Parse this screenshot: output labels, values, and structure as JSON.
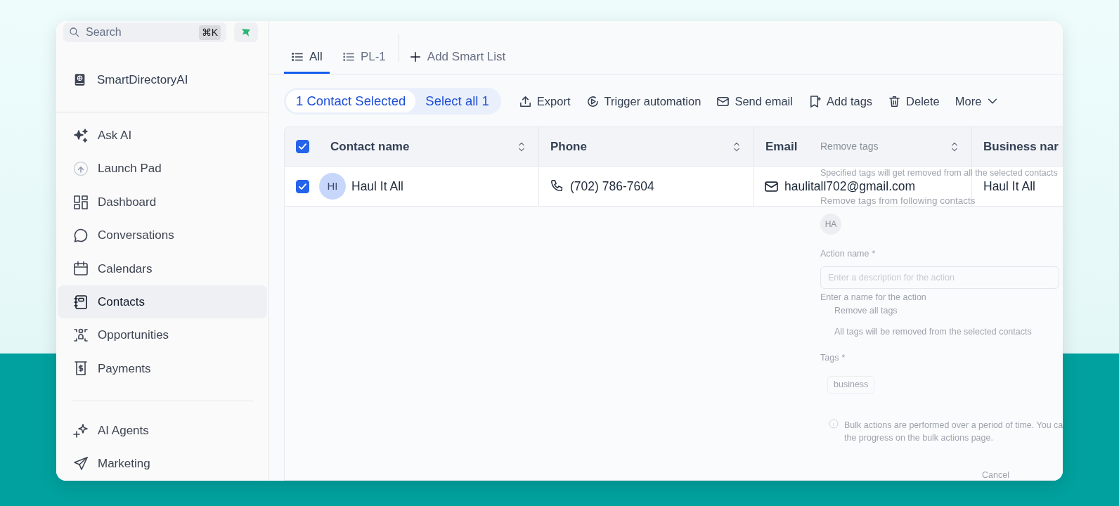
{
  "sidebar": {
    "search": {
      "placeholder": "Search",
      "shortcut": "⌘K"
    },
    "account": {
      "name": "SmartDirectoryAI"
    },
    "items": [
      {
        "label": "Ask AI",
        "selected": false
      },
      {
        "label": "Launch Pad",
        "selected": false
      },
      {
        "label": "Dashboard",
        "selected": false
      },
      {
        "label": "Conversations",
        "selected": false
      },
      {
        "label": "Calendars",
        "selected": false
      },
      {
        "label": "Contacts",
        "selected": true
      },
      {
        "label": "Opportunities",
        "selected": false
      },
      {
        "label": "Payments",
        "selected": false
      }
    ],
    "items_2": [
      {
        "label": "AI Agents",
        "selected": false
      },
      {
        "label": "Marketing",
        "selected": false
      }
    ]
  },
  "tabs": [
    {
      "label": "All",
      "selected": true
    },
    {
      "label": "PL-1",
      "selected": false
    }
  ],
  "add_tab": {
    "label": "Add Smart List"
  },
  "selection": {
    "count_label": "1 Contact Selected",
    "select_all": "Select all 1"
  },
  "actions": [
    {
      "label": "Export",
      "kind": "action"
    },
    {
      "label": "Trigger automation",
      "kind": "action"
    },
    {
      "label": "Send email",
      "kind": "action"
    },
    {
      "label": "Add tags",
      "kind": "action"
    },
    {
      "label": "Delete",
      "kind": "action"
    },
    {
      "label": "More",
      "kind": "menu"
    }
  ],
  "table": {
    "select_all_checked": true,
    "columns": [
      {
        "label": "Contact name",
        "sortable": true
      },
      {
        "label": "Phone",
        "sortable": true
      },
      {
        "label": "Email",
        "sortable": true
      },
      {
        "label": "Business nar"
      }
    ],
    "rows": [
      {
        "checked": true,
        "initials": "HI",
        "name": "Haul It All",
        "phone": "(702) 786-7604",
        "email": "haulitall702@gmail.com",
        "business": "Haul It All"
      }
    ]
  },
  "fading_panel": {
    "title": "Remove tags",
    "subtitle": "Specified tags will get removed from all the selected contacts",
    "contacts_label": "Remove tags from following contacts",
    "contact_initials": "HA",
    "action_label": "Action name",
    "action_required": "*",
    "action_placeholder": "Enter a description for the action",
    "action_help": "Enter a name for the action",
    "remove_all_label": "Remove all tags",
    "remove_all_help": "All tags will be removed from the selected contacts",
    "tags_label": "Tags",
    "tags_required": "*",
    "tag": "business",
    "info_line_1": "Bulk actions are performed over a period of time. You ca",
    "info_line_2": "the progress on the bulk actions page.",
    "cancel": "Cancel"
  }
}
